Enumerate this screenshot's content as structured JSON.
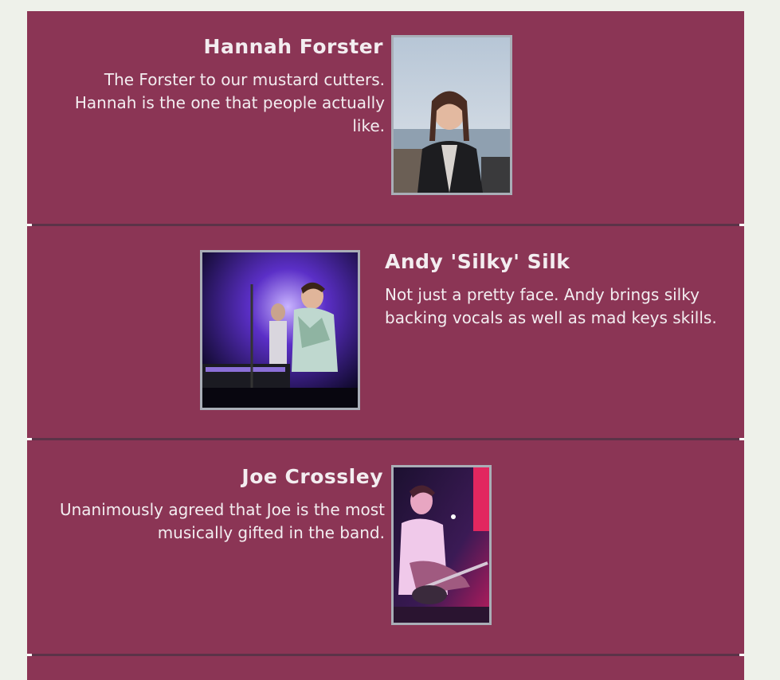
{
  "members": [
    {
      "name": "Hannah Forster",
      "bio": "The Forster to our mustard cutters. Hannah is the one that people actually like.",
      "photo_icon": "portrait-photo-seaside"
    },
    {
      "name": "Andy 'Silky' Silk",
      "bio": "Not just a pretty face. Andy brings silky backing vocals as well as mad keys skills.",
      "photo_icon": "keyboard-player-photo"
    },
    {
      "name": "Joe Crossley",
      "bio": "Unanimously agreed that Joe is the most musically gifted in the band.",
      "photo_icon": "guitarist-photo"
    }
  ],
  "colors": {
    "page_background": "#eef1ea",
    "panel_background": "#8b3555",
    "divider": "#5b3348",
    "text": "#f3edf0",
    "photo_border": "#a9aeb7"
  }
}
